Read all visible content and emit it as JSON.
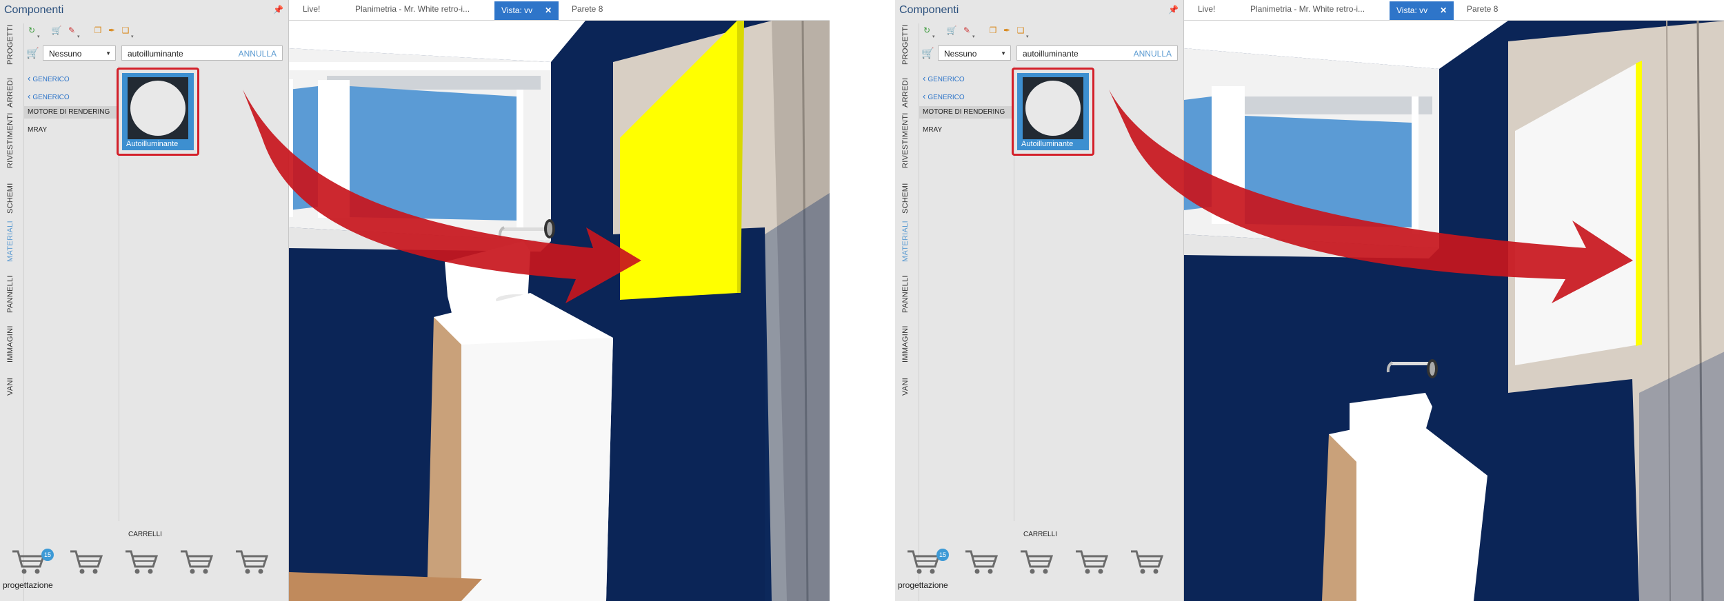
{
  "panel": {
    "title": "Componenti",
    "vertical_tabs": [
      "PROGETTI",
      "ARREDI",
      "RIVESTIMENTI",
      "SCHEMI",
      "MATERIALI",
      "PANNELLI",
      "IMMAGINI",
      "VANI"
    ],
    "active_tab": "MATERIALI",
    "cart_selector": "Nessuno",
    "search_value": "autoilluminante",
    "cancel_label": "ANNULLA",
    "breadcrumbs": [
      "GENERICO",
      "GENERICO"
    ],
    "tree_items": [
      "MOTORE DI RENDERING",
      "MRAY"
    ],
    "material_label": "Autoilluminante",
    "carts_title": "CARRELLI",
    "cart_badge": "15",
    "cart_caption": "progettazione"
  },
  "tabs": [
    {
      "label": "Live!"
    },
    {
      "label": "Planimetria - Mr. White retro-i..."
    },
    {
      "label": "Vista: vv",
      "active": true
    },
    {
      "label": "Parete 8"
    }
  ],
  "colors": {
    "accent_blue": "#2e75c9",
    "highlight_red": "#d4202a",
    "panel_yellow": "#ffff00",
    "wall_navy": "#0b2557"
  },
  "views": [
    {
      "panel_state": "yellow-lit"
    },
    {
      "panel_state": "white-with-yellow-edge"
    }
  ]
}
